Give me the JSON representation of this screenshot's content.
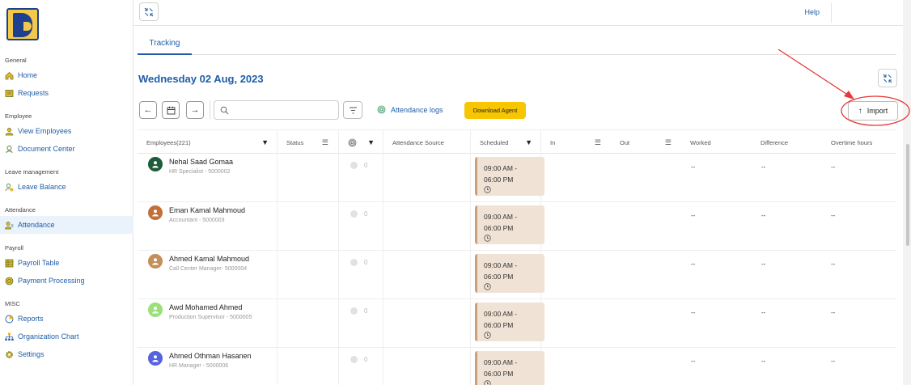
{
  "sidebar": {
    "sections": [
      {
        "title": "General",
        "items": [
          {
            "label": "Home",
            "icon": "home-icon"
          },
          {
            "label": "Requests",
            "icon": "requests-icon"
          }
        ]
      },
      {
        "title": "Employee",
        "items": [
          {
            "label": "View Employees",
            "icon": "user-icon"
          },
          {
            "label": "Document Center",
            "icon": "document-icon"
          }
        ]
      },
      {
        "title": "Leave management",
        "items": [
          {
            "label": "Leave Balance",
            "icon": "leave-icon"
          }
        ]
      },
      {
        "title": "Attendance",
        "items": [
          {
            "label": "Attendance",
            "icon": "attendance-icon",
            "active": true
          }
        ]
      },
      {
        "title": "Payroll",
        "items": [
          {
            "label": "Payroll Table",
            "icon": "table-icon"
          },
          {
            "label": "Payment Processing",
            "icon": "payment-icon"
          }
        ]
      },
      {
        "title": "MISC",
        "items": [
          {
            "label": "Reports",
            "icon": "reports-icon"
          },
          {
            "label": "Organization Chart",
            "icon": "org-chart-icon"
          },
          {
            "label": "Settings",
            "icon": "settings-icon"
          }
        ]
      }
    ]
  },
  "topbar": {
    "help_label": "Help"
  },
  "tabs": {
    "tracking": "Tracking"
  },
  "header": {
    "date": "Wednesday 02 Aug, 2023"
  },
  "toolbar": {
    "search_placeholder": "",
    "attendance_logs": "Attendance logs",
    "download_agent": "Download Agent",
    "import_label": "Import"
  },
  "table": {
    "columns": {
      "employees": "Employees(221)",
      "status": "Status",
      "attendance_source": "Attendance Source",
      "scheduled": "Scheduled",
      "in": "In",
      "out": "Out",
      "worked": "Worked",
      "difference": "Difference",
      "overtime": "Overtime hours"
    },
    "rows": [
      {
        "name": "Nehal Saad Gomaa",
        "role": "HR Specialist - 5000002",
        "avatar_color": "#1e5c3a",
        "fp_count": "0",
        "schedule_line1": "09:00 AM -",
        "schedule_line2": "06:00 PM",
        "worked": "--",
        "difference": "--",
        "overtime": "--"
      },
      {
        "name": "Eman Kamal Mahmoud",
        "role": "Accountant - 5000003",
        "avatar_color": "#c2703a",
        "fp_count": "0",
        "schedule_line1": "09:00 AM -",
        "schedule_line2": "06:00 PM",
        "worked": "--",
        "difference": "--",
        "overtime": "--"
      },
      {
        "name": "Ahmed Kamal Mahmoud",
        "role": "Call Center Manager- 5000004",
        "avatar_color": "#c48f5a",
        "fp_count": "0",
        "schedule_line1": "09:00 AM -",
        "schedule_line2": "06:00 PM",
        "worked": "--",
        "difference": "--",
        "overtime": "--"
      },
      {
        "name": "Awd Mohamed Ahmed",
        "role": "Production Supervisor - 5000005",
        "avatar_color": "#9be07a",
        "fp_count": "0",
        "schedule_line1": "09:00 AM -",
        "schedule_line2": "06:00 PM",
        "worked": "--",
        "difference": "--",
        "overtime": "--"
      },
      {
        "name": "Ahmed Othman Hasanen",
        "role": "HR Manager - 5000006",
        "avatar_color": "#5563e0",
        "fp_count": "0",
        "schedule_line1": "09:00 AM -",
        "schedule_line2": "06:00 PM",
        "worked": "--",
        "difference": "--",
        "overtime": "--"
      }
    ]
  },
  "colors": {
    "accent": "#1e5ea8",
    "download_button": "#f7c600",
    "schedule_bg": "#f0e2d4",
    "annotation": "#e53935"
  }
}
